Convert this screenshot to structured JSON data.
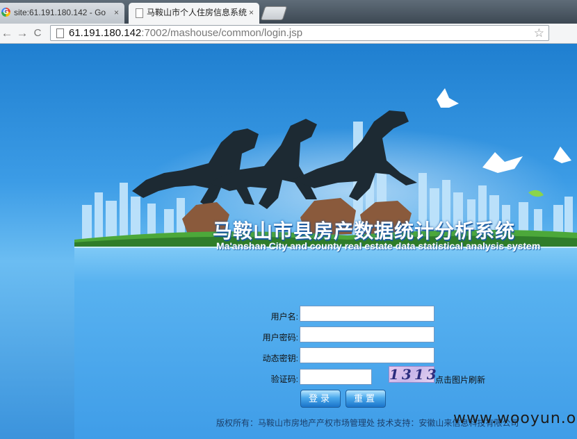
{
  "browser": {
    "tabs": [
      {
        "title": "site:61.191.180.142 - Go",
        "close": "×",
        "active": false
      },
      {
        "title": "马鞍山市个人住房信息系统",
        "close": "×",
        "active": true
      }
    ],
    "nav": {
      "back": "←",
      "forward": "→",
      "reload": "C"
    },
    "address": {
      "host": "61.191.180.142",
      "path": ":7002/mashouse/common/login.jsp"
    },
    "bookmark_star": "☆"
  },
  "page": {
    "title_cn": "马鞍山市县房产数据统计分析系统",
    "title_en": "Ma'anshan City and county real estate data statistical analysis system",
    "form": {
      "username_label": "用户名:",
      "username_value": "",
      "password_label": "用户密码:",
      "password_value": "",
      "token_label": "动态密钥:",
      "token_value": "",
      "captcha_label": "验证码:",
      "captcha_value": "",
      "captcha_image_text": "1313",
      "captcha_hint": "点击图片刷新",
      "login_button": "登录",
      "reset_button": "重置"
    },
    "footer": "版权所有：马鞍山市房地产产权市场管理处  技术支持：安徽山来信息科技有限公司",
    "watermark": "www.wooyun.org"
  },
  "colors": {
    "accent": "#2a8fd8",
    "annotation_arrow": "#e8231f"
  }
}
